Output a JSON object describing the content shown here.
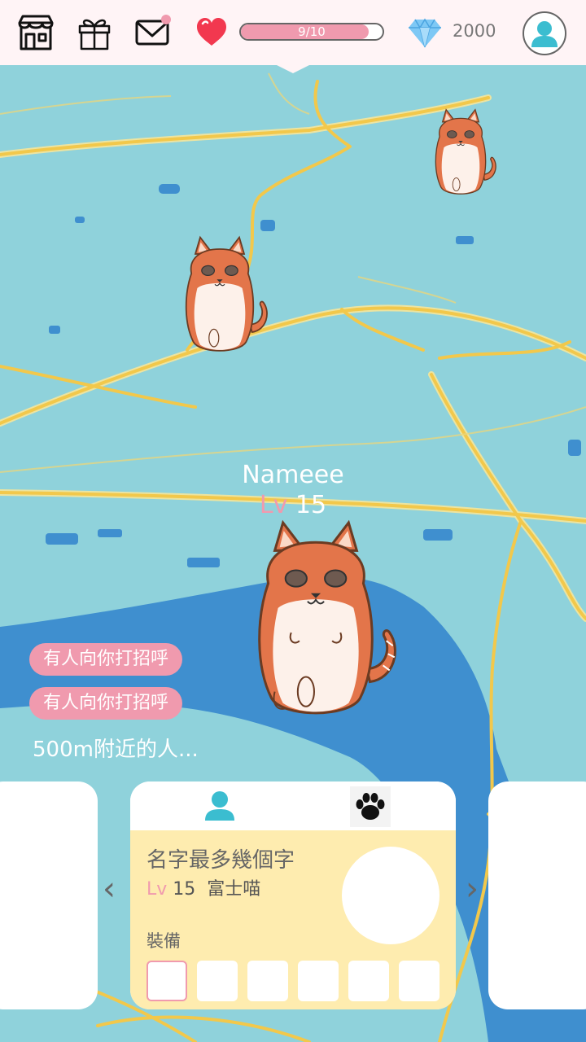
{
  "topbar": {
    "icons": [
      "shop-icon",
      "gift-icon",
      "mail-icon"
    ],
    "mail_has_notification": true,
    "hp": {
      "current": 9,
      "max": 10,
      "text": "9/10",
      "fill_fraction": 0.9
    },
    "gems": "2000",
    "colors": {
      "bar_bg": "#fff4f6",
      "accent_pink": "#f09aae",
      "heart": "#f2384f",
      "diamond": "#7ec8f5",
      "avatar": "#3bbdd0"
    }
  },
  "map": {
    "colors": {
      "water": "#8fd2db",
      "river": "#3f8fcf",
      "road": "#f2c84b",
      "road_edge": "#f6e69b"
    }
  },
  "player": {
    "name": "Nameee",
    "level_label": "Lv",
    "level_value": "15"
  },
  "notifications": [
    "有人向你打招呼",
    "有人向你打招呼"
  ],
  "nearby_label": "500m附近的人...",
  "card": {
    "tabs": [
      "person-icon",
      "paw-icon"
    ],
    "name": "名字最多幾個字",
    "level_label": "Lv",
    "level_value": "15",
    "breed": "富士喵",
    "equip_label": "裝備",
    "equip_slots": 6,
    "selected_slot": 0
  },
  "nav": {
    "prev": "‹",
    "next": "›"
  }
}
